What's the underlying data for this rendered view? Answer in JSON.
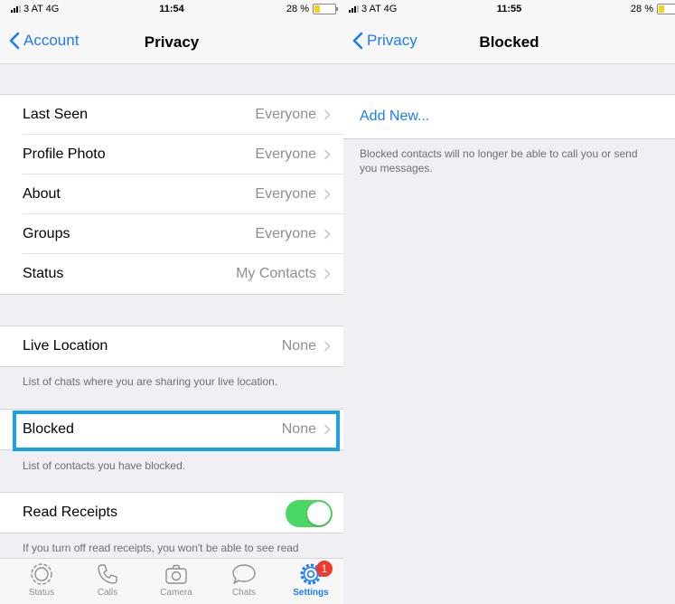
{
  "left": {
    "status": {
      "carrier": "3 AT  4G",
      "time": "11:54",
      "battery": "28 %",
      "battery_level": 0.28
    },
    "nav": {
      "back": "Account",
      "title": "Privacy"
    },
    "rows": [
      {
        "label": "Last Seen",
        "value": "Everyone"
      },
      {
        "label": "Profile Photo",
        "value": "Everyone"
      },
      {
        "label": "About",
        "value": "Everyone"
      },
      {
        "label": "Groups",
        "value": "Everyone"
      },
      {
        "label": "Status",
        "value": "My Contacts"
      }
    ],
    "live_location": {
      "label": "Live Location",
      "value": "None",
      "footer": "List of chats where you are sharing your live location."
    },
    "blocked": {
      "label": "Blocked",
      "value": "None",
      "footer": "List of contacts you have blocked."
    },
    "read_receipts": {
      "label": "Read Receipts",
      "enabled": true,
      "footer": "If you turn off read receipts, you won't be able to see read receipts from other people. Read receipts are"
    },
    "tabs": [
      {
        "label": "Status",
        "icon": "status-icon"
      },
      {
        "label": "Calls",
        "icon": "phone-icon"
      },
      {
        "label": "Camera",
        "icon": "camera-icon"
      },
      {
        "label": "Chats",
        "icon": "chat-bubble-icon"
      },
      {
        "label": "Settings",
        "icon": "gear-icon",
        "badge": "1",
        "active": true
      }
    ]
  },
  "right": {
    "status": {
      "carrier": "3 AT  4G",
      "time": "11:55",
      "battery": "28 %",
      "battery_level": 0.28
    },
    "nav": {
      "back": "Privacy",
      "title": "Blocked"
    },
    "add_new": "Add New...",
    "footer": "Blocked contacts will no longer be able to call you or send you messages."
  },
  "colors": {
    "accent": "#1a7cf6",
    "toggle_on": "#4bd763",
    "highlight": "#1da1e6",
    "badge": "#f03a2e",
    "battery": "#f5d21b"
  }
}
